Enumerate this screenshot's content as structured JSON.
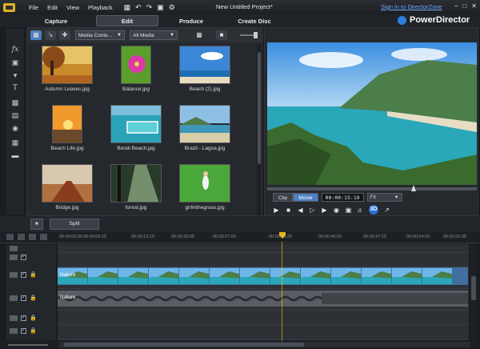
{
  "window": {
    "menu": [
      "File",
      "Edit",
      "View",
      "Playback"
    ],
    "title": "New Untitled Project*",
    "signin": "Sign in to DirectorZone",
    "controls": [
      "–",
      "□",
      "✕"
    ]
  },
  "modes": {
    "capture": "Capture",
    "edit": "Edit",
    "produce": "Produce",
    "create_disc": "Create Disc"
  },
  "brand": "PowerDirector",
  "library": {
    "filter1": "Media Conte...",
    "filter2": "All Media",
    "items": [
      {
        "label": "Autumn Leaves.jpg"
      },
      {
        "label": "Balance.jpg"
      },
      {
        "label": "Beach (2).jpg"
      },
      {
        "label": "Beach Life.jpg"
      },
      {
        "label": "Bondi Beach.jpg"
      },
      {
        "label": "Brazil - Lagoa.jpg"
      },
      {
        "label": "Bridge.jpg"
      },
      {
        "label": "forest.jpg"
      },
      {
        "label": "girlinthegrass.jpg"
      }
    ]
  },
  "preview": {
    "clip_label": "Clip",
    "movie_label": "Movie",
    "timecode": "00:00:15:19",
    "fit": "Fit",
    "threed": "3D"
  },
  "edit_bar": {
    "split_label": "Split"
  },
  "timeline": {
    "ticks": [
      "00:00:00:00",
      "00:00:06:15",
      "00:00:13:10",
      "00:00:20:05",
      "00:00:27:00",
      "00:00:33:25",
      "00:00:40:20",
      "00:00:47:15",
      "00:00:54:10",
      "00:01:01:05"
    ],
    "video_clip_label": "Nature",
    "audio_clip_label": "Nature"
  }
}
